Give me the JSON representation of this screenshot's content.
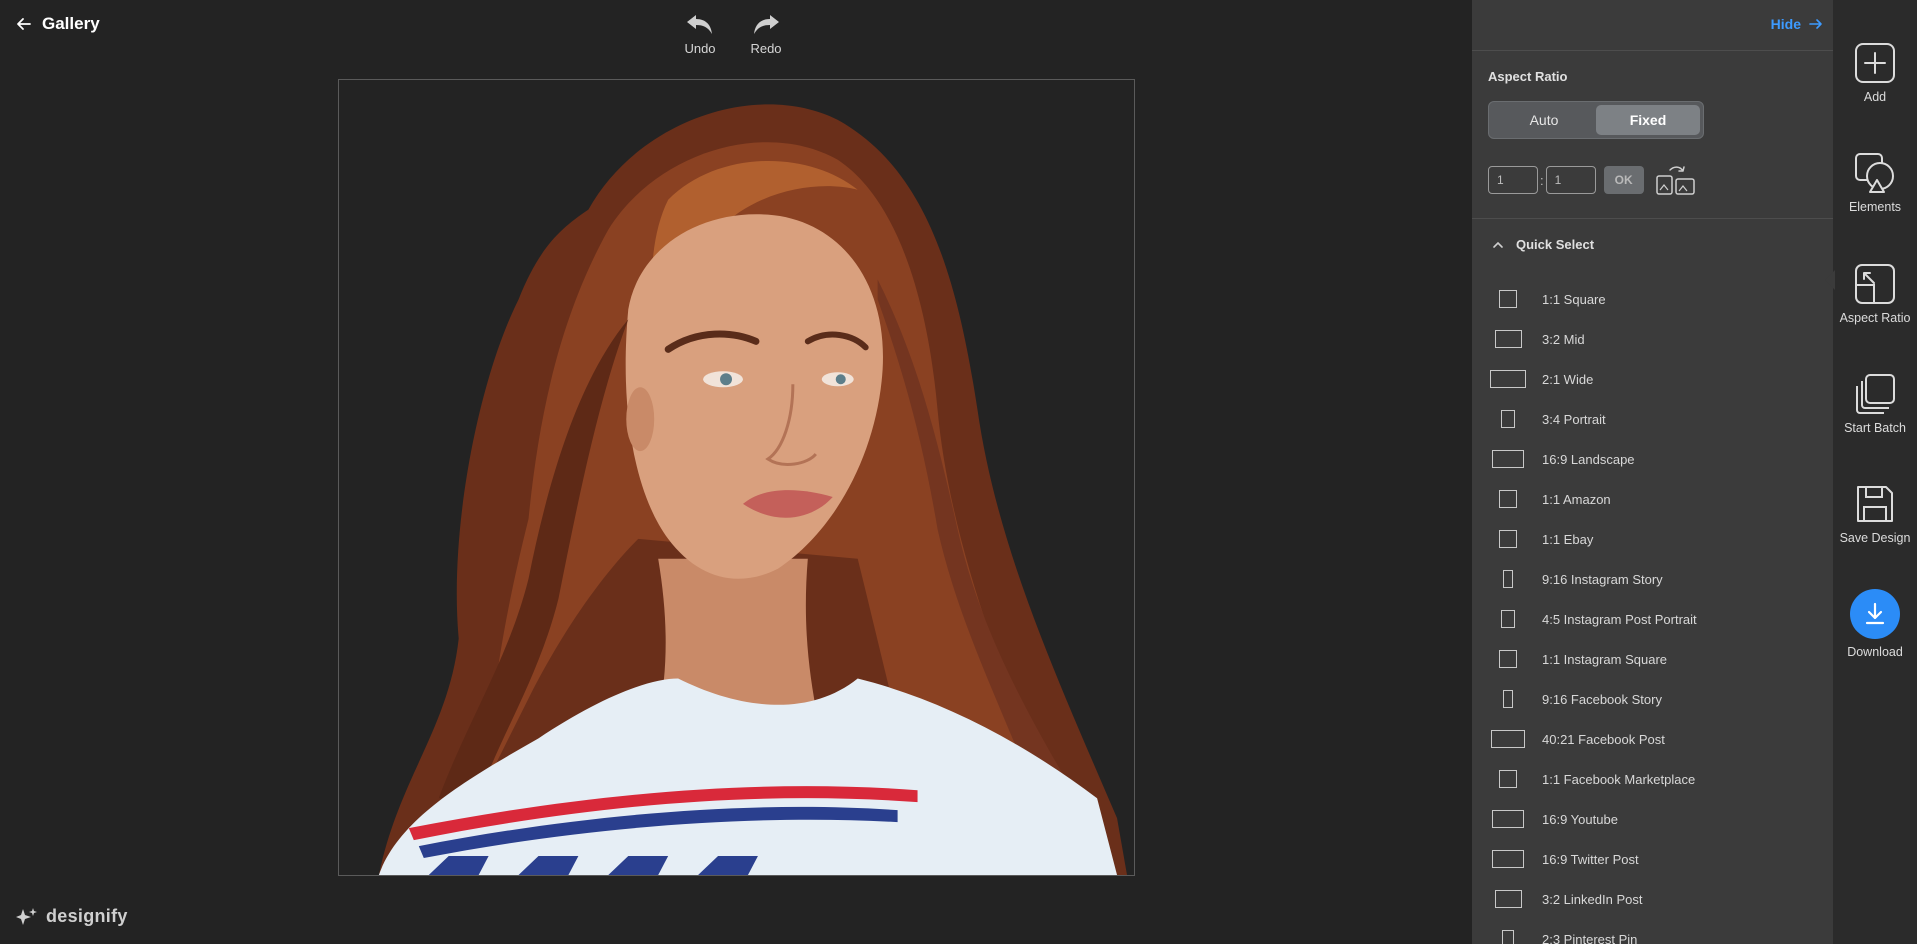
{
  "header": {
    "back_label": "Gallery",
    "undo_label": "Undo",
    "redo_label": "Redo"
  },
  "brand": {
    "logo_text": "designify"
  },
  "panel": {
    "hide_label": "Hide",
    "aspect_ratio_title": "Aspect Ratio",
    "toggle": {
      "auto": "Auto",
      "fixed": "Fixed",
      "selected": "Fixed"
    },
    "ratio_w": "1",
    "ratio_h": "1",
    "ok_label": "OK",
    "quick_select_label": "Quick Select",
    "presets": [
      {
        "label": "1:1 Square",
        "ratio": [
          1,
          1
        ]
      },
      {
        "label": "3:2 Mid",
        "ratio": [
          3,
          2
        ]
      },
      {
        "label": "2:1 Wide",
        "ratio": [
          2,
          1
        ]
      },
      {
        "label": "3:4 Portrait",
        "ratio": [
          3,
          4
        ]
      },
      {
        "label": "16:9 Landscape",
        "ratio": [
          16,
          9
        ]
      },
      {
        "label": "1:1 Amazon",
        "ratio": [
          1,
          1
        ]
      },
      {
        "label": "1:1 Ebay",
        "ratio": [
          1,
          1
        ]
      },
      {
        "label": "9:16 Instagram Story",
        "ratio": [
          9,
          16
        ]
      },
      {
        "label": "4:5 Instagram Post Portrait",
        "ratio": [
          4,
          5
        ]
      },
      {
        "label": "1:1 Instagram Square",
        "ratio": [
          1,
          1
        ]
      },
      {
        "label": "9:16 Facebook Story",
        "ratio": [
          9,
          16
        ]
      },
      {
        "label": "40:21 Facebook Post",
        "ratio": [
          40,
          21
        ]
      },
      {
        "label": "1:1 Facebook Marketplace",
        "ratio": [
          1,
          1
        ]
      },
      {
        "label": "16:9 Youtube",
        "ratio": [
          16,
          9
        ]
      },
      {
        "label": "16:9 Twitter Post",
        "ratio": [
          16,
          9
        ]
      },
      {
        "label": "3:2 LinkedIn Post",
        "ratio": [
          3,
          2
        ]
      },
      {
        "label": "2:3 Pinterest Pin",
        "ratio": [
          2,
          3
        ]
      }
    ]
  },
  "rail": {
    "add": "Add",
    "elements": "Elements",
    "aspect_ratio": "Aspect Ratio",
    "start_batch": "Start Batch",
    "save_design": "Save Design",
    "download": "Download",
    "active": "Aspect Ratio"
  },
  "colors": {
    "accent": "#2b8cf7",
    "link": "#3d9bff",
    "background": "#232323",
    "panel": "#3b3b3b",
    "rail": "#2b2b2b"
  },
  "icons": [
    "arrow-left-icon",
    "undo-icon",
    "redo-icon",
    "arrow-right-icon",
    "swap-orientation-icon",
    "chevron-up-icon",
    "add-icon",
    "elements-icon",
    "aspect-ratio-icon",
    "batch-icon",
    "save-icon",
    "download-icon",
    "sparkle-logo-icon"
  ]
}
